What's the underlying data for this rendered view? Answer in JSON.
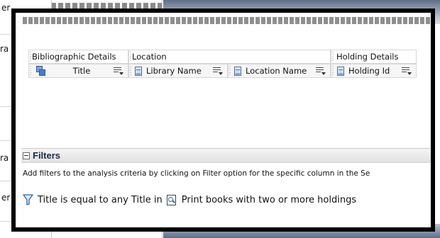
{
  "background": {
    "fragments": [
      {
        "text": "er"
      },
      {
        "text": "ra"
      },
      {
        "text": "ra"
      },
      {
        "text": "er"
      }
    ]
  },
  "criteria": {
    "groups": [
      {
        "label": "Bibliographic Details"
      },
      {
        "label": "Location"
      },
      {
        "label": "Holding Details"
      }
    ],
    "columns": [
      {
        "label": "Title",
        "icon": "hierarchy-icon"
      },
      {
        "label": "Library Name",
        "icon": "attribute-column-icon"
      },
      {
        "label": "Location Name",
        "icon": "attribute-column-icon"
      },
      {
        "label": "Holding Id",
        "icon": "attribute-column-icon"
      }
    ]
  },
  "filters": {
    "title": "Filters",
    "description": "Add filters to the analysis criteria by clicking on Filter option for the specific column in the Se",
    "filter_text_prefix": "Title is equal to any  Title in",
    "saved_analysis_name": "Print books with two or more holdings"
  },
  "colors": {
    "filters_title": "#1c2b44",
    "icon_blue": "#2a63b8",
    "callout_border": "#000000"
  }
}
